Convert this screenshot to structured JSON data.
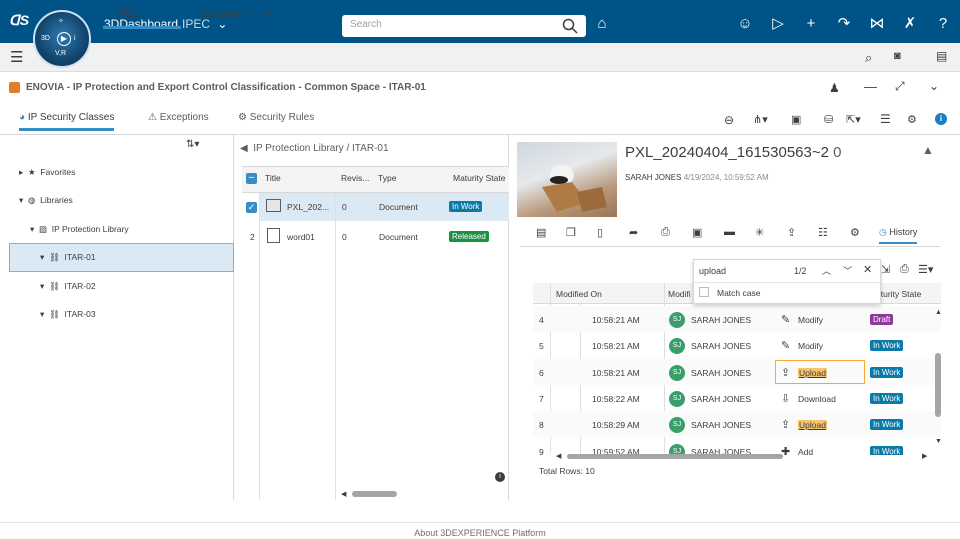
{
  "topbar": {
    "app": "3DDashboard",
    "space": "IPEC",
    "compass_q": [
      "3D",
      "V,R"
    ],
    "search_placeholder": "Search"
  },
  "tabs": {
    "items": [
      {
        "label": "IPEC"
      },
      {
        "label": "Document"
      }
    ]
  },
  "app_header": {
    "title": "ENOVIA - IP Protection and Export Control Classification - Common Space - ITAR-01"
  },
  "subtabs": [
    {
      "label": "IP Security Classes"
    },
    {
      "label": "Exceptions"
    },
    {
      "label": "Security Rules"
    }
  ],
  "tree": {
    "favorites": "Favorites",
    "libraries": "Libraries",
    "library": "IP Protection Library",
    "classes": [
      "ITAR-01",
      "ITAR-02",
      "ITAR-03"
    ]
  },
  "middle": {
    "breadcrumb": [
      "IP Protection Library",
      "ITAR-01"
    ],
    "sep": "/",
    "columns": [
      "Title",
      "Revis...",
      "Type",
      "Maturity State"
    ],
    "rows": [
      {
        "num": "",
        "title": "PXL_202...",
        "rev": "0",
        "type": "Document",
        "state": "In Work"
      },
      {
        "num": "2",
        "title": "word01",
        "rev": "0",
        "type": "Document",
        "state": "Released"
      }
    ]
  },
  "detail": {
    "title": "PXL_20240404_161530563~2",
    "rev": "0",
    "author": "SARAH JONES",
    "date": "4/19/2024, 10:59:52 AM",
    "history_tab": "History"
  },
  "find": {
    "query": "upload",
    "count": "1/2",
    "match_case": "Match case"
  },
  "history": {
    "columns": [
      "Modified On",
      "Modifi",
      "aturity State"
    ],
    "rows": [
      {
        "n": "4",
        "time": "10:58:21 AM",
        "initials": "SJ",
        "user": "SARAH JONES",
        "action": "Modify",
        "state": "Draft"
      },
      {
        "n": "5",
        "time": "10:58:21 AM",
        "initials": "SJ",
        "user": "SARAH JONES",
        "action": "Modify",
        "state": "In Work"
      },
      {
        "n": "6",
        "time": "10:58:21 AM",
        "initials": "SJ",
        "user": "SARAH JONES",
        "action": "Upload",
        "state": "In Work"
      },
      {
        "n": "7",
        "time": "10:58:22 AM",
        "initials": "SJ",
        "user": "SARAH JONES",
        "action": "Download",
        "state": "In Work"
      },
      {
        "n": "8",
        "time": "10:58:29 AM",
        "initials": "SJ",
        "user": "SARAH JONES",
        "action": "Upload",
        "state": "In Work"
      },
      {
        "n": "9",
        "time": "10:59:52 AM",
        "initials": "SJ",
        "user": "SARAH JONES",
        "action": "Add",
        "state": "In Work"
      }
    ],
    "total_rows": "Total Rows: 10"
  },
  "footer": "About 3DEXPERIENCE Platform",
  "colors": {
    "topbar": "#005386",
    "accent": "#368ec4",
    "inwork": "#0a7aa8",
    "released": "#1a9140",
    "draft": "#8e3a9a"
  }
}
